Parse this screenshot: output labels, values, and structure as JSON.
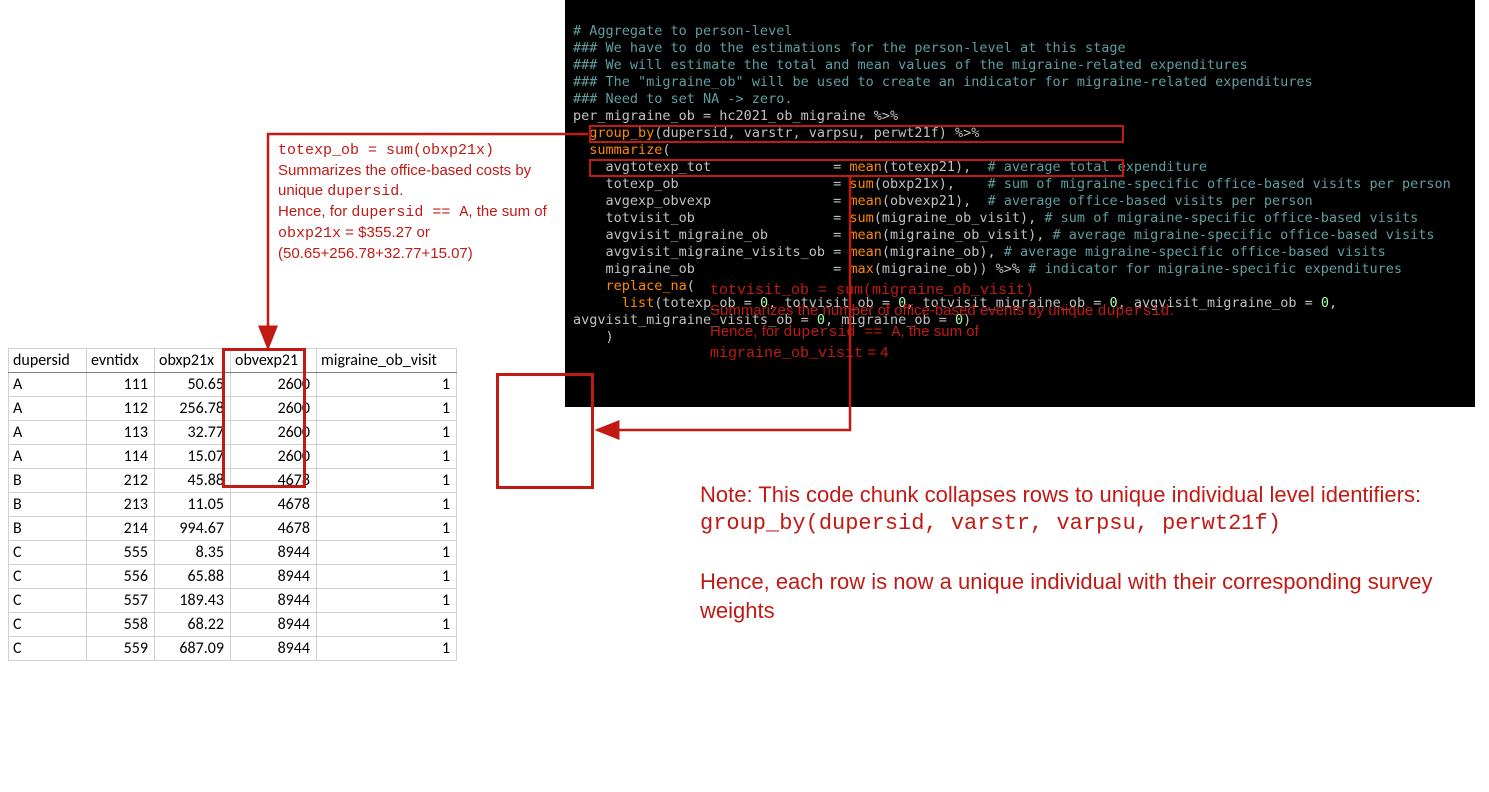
{
  "code": {
    "lines": [
      "# Aggregate to person-level",
      "### We have to do the estimations for the person-level at this stage",
      "### We will estimate the total and mean values of the migraine-related expenditures",
      "### The \"migraine_ob\" will be used to create an indicator for migraine-related expenditures",
      "### Need to set NA -> zero.",
      "per_migraine_ob = hc2021_ob_migraine %>%",
      "  group_by(dupersid, varstr, varpsu, perwt21f) %>%",
      "  summarize(",
      "    avgtotexp_tot               = mean(totexp21),  # average total expenditure",
      "    totexp_ob                   = sum(obxp21x),    # sum of migraine-specific office-based visits per person",
      "    avgexp_obvexp               = mean(obvexp21),  # average office-based visits per person",
      "    totvisit_ob                 = sum(migraine_ob_visit), # sum of migraine-specific office-based visits",
      "    avgvisit_migraine_ob        = mean(migraine_ob_visit), # average migraine-specific office-based visits",
      "    avgvisit_migraine_visits_ob = mean(migraine_ob), # average migraine-specific office-based visits",
      "    migraine_ob                 = max(migraine_ob)) %>% # indicator for migraine-specific expenditures",
      "    replace_na(",
      "      list(totexp_ob = 0, totvisit_ob = 0, totvisit_migraine_ob = 0, avgvisit_migraine_ob = 0,",
      "avgvisit_migraine_visits_ob = 0, migraine_ob = 0)",
      "    )"
    ]
  },
  "left_annot": {
    "code": "totexp_ob = sum(obxp21x)",
    "l2": "Summarizes the office-based costs by unique ",
    "dupersid": "dupersid",
    "l3a": "Hence, for ",
    "l3b": "dupersid == A",
    "l3c": ", the sum of ",
    "l3d": "obxp21x",
    "l3e": " = $355.27 or (50.65+256.78+32.77+15.07)"
  },
  "right_annot": {
    "code": "totvisit_ob = sum(migraine_ob_visit)",
    "l2a": "Summarizes the number of office-based events by unique ",
    "dupersid": "dupersid",
    "l3a": "Hence, for ",
    "l3b": "dupersid == A",
    "l3c": ", the sum of ",
    "l4a": "migraine_ob_visit",
    "l4b": " = 4"
  },
  "note": {
    "l1": "Note: This code chunk collapses rows to unique individual level identifiers:",
    "code": "group_by(dupersid, varstr, varpsu, perwt21f)",
    "l3": "Hence, each row is now a unique individual with their corresponding survey weights"
  },
  "table": {
    "headers": [
      "dupersid",
      "evntidx",
      "obxp21x",
      "obvexp21",
      "migraine_ob_visit"
    ],
    "rows": [
      [
        "A",
        "111",
        "50.65",
        "2600",
        "1"
      ],
      [
        "A",
        "112",
        "256.78",
        "2600",
        "1"
      ],
      [
        "A",
        "113",
        "32.77",
        "2600",
        "1"
      ],
      [
        "A",
        "114",
        "15.07",
        "2600",
        "1"
      ],
      [
        "B",
        "212",
        "45.88",
        "4678",
        "1"
      ],
      [
        "B",
        "213",
        "11.05",
        "4678",
        "1"
      ],
      [
        "B",
        "214",
        "994.67",
        "4678",
        "1"
      ],
      [
        "C",
        "555",
        "8.35",
        "8944",
        "1"
      ],
      [
        "C",
        "556",
        "65.88",
        "8944",
        "1"
      ],
      [
        "C",
        "557",
        "189.43",
        "8944",
        "1"
      ],
      [
        "C",
        "558",
        "68.22",
        "8944",
        "1"
      ],
      [
        "C",
        "559",
        "687.09",
        "8944",
        "1"
      ]
    ]
  }
}
